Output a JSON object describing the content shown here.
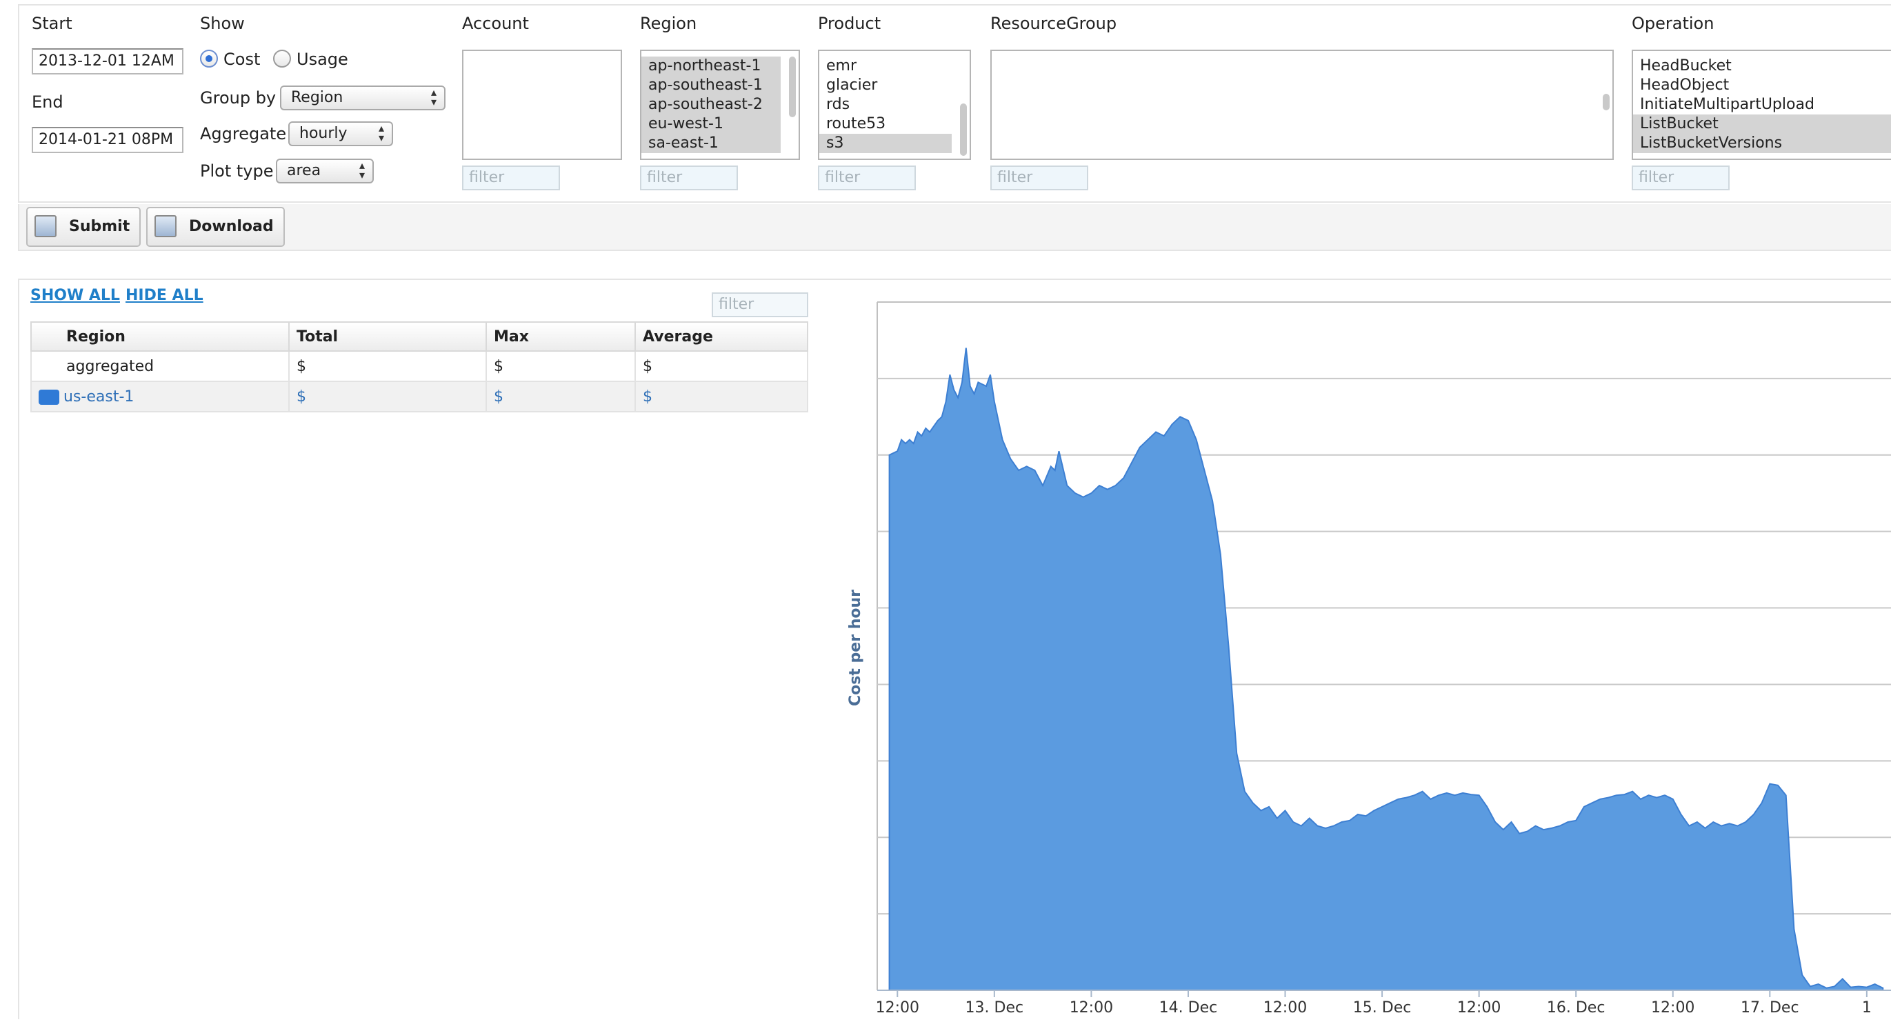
{
  "controls": {
    "start_label": "Start",
    "start_value": "2013-12-01 12AM",
    "end_label": "End",
    "end_value": "2014-01-21 08PM",
    "show_label": "Show",
    "cost_label": "Cost",
    "usage_label": "Usage",
    "show_selected": "Cost",
    "group_by_label": "Group by",
    "group_by_value": "Region",
    "aggregate_label": "Aggregate",
    "aggregate_value": "hourly",
    "plot_type_label": "Plot type",
    "plot_type_value": "area"
  },
  "filters": {
    "account": {
      "label": "Account",
      "options": [],
      "filter_placeholder": "filter"
    },
    "region": {
      "label": "Region",
      "options": [
        "ap-northeast-1",
        "ap-southeast-1",
        "ap-southeast-2",
        "eu-west-1",
        "sa-east-1"
      ],
      "selected": [
        "ap-northeast-1",
        "ap-southeast-1",
        "ap-southeast-2",
        "eu-west-1",
        "sa-east-1"
      ],
      "filter_placeholder": "filter"
    },
    "product": {
      "label": "Product",
      "options": [
        "emr",
        "glacier",
        "rds",
        "route53",
        "s3"
      ],
      "selected": [
        "s3"
      ],
      "filter_placeholder": "filter"
    },
    "resource_group": {
      "label": "ResourceGroup",
      "options": [],
      "filter_placeholder": "filter"
    },
    "operation": {
      "label": "Operation",
      "options": [
        "HeadBucket",
        "HeadObject",
        "InitiateMultipartUpload",
        "ListBucket",
        "ListBucketVersions"
      ],
      "selected": [
        "ListBucket",
        "ListBucketVersions"
      ],
      "filter_placeholder": "filter"
    }
  },
  "toolbar": {
    "submit_label": "Submit",
    "download_label": "Download"
  },
  "legend_panel": {
    "show_all": "SHOW ALL",
    "hide_all": "HIDE ALL",
    "filter_placeholder": "filter",
    "columns": [
      "Region",
      "Total",
      "Max",
      "Average"
    ],
    "rows": [
      {
        "name": "aggregated",
        "total": "$",
        "max": "$",
        "average": "$"
      },
      {
        "name": "us-east-1",
        "total": "$",
        "max": "$",
        "average": "$",
        "color": "#2f7ad6"
      }
    ]
  },
  "chart_data": {
    "type": "area",
    "ylabel": "Cost per hour",
    "series": [
      {
        "name": "us-east-1",
        "color": "#5b9be0"
      }
    ],
    "x_tick_labels": [
      "12:00",
      "13. Dec",
      "12:00",
      "14. Dec",
      "12:00",
      "15. Dec",
      "12:00",
      "16. Dec",
      "12:00",
      "17. Dec",
      "1"
    ],
    "x_hours": [
      0,
      12,
      24,
      36,
      48,
      60,
      72,
      84,
      96,
      108,
      120
    ],
    "y_gridlines": 9,
    "ylim": [
      0,
      9
    ],
    "note_y": "y values in gridline units (axis tick labels not shown)",
    "points": [
      [
        -1,
        7.0
      ],
      [
        0,
        7.05
      ],
      [
        0.5,
        7.2
      ],
      [
        1,
        7.15
      ],
      [
        1.5,
        7.2
      ],
      [
        2,
        7.15
      ],
      [
        2.5,
        7.3
      ],
      [
        3,
        7.25
      ],
      [
        3.5,
        7.35
      ],
      [
        4,
        7.3
      ],
      [
        5,
        7.45
      ],
      [
        5.5,
        7.5
      ],
      [
        6,
        7.7
      ],
      [
        6.5,
        8.05
      ],
      [
        7,
        7.85
      ],
      [
        7.5,
        7.75
      ],
      [
        8,
        7.95
      ],
      [
        8.5,
        8.4
      ],
      [
        9,
        7.9
      ],
      [
        9.5,
        7.8
      ],
      [
        10,
        7.95
      ],
      [
        11,
        7.9
      ],
      [
        11.5,
        8.05
      ],
      [
        12,
        7.7
      ],
      [
        13,
        7.2
      ],
      [
        14,
        6.95
      ],
      [
        15,
        6.8
      ],
      [
        16,
        6.85
      ],
      [
        17,
        6.8
      ],
      [
        18,
        6.6
      ],
      [
        19,
        6.85
      ],
      [
        19.5,
        6.8
      ],
      [
        20,
        7.05
      ],
      [
        21,
        6.6
      ],
      [
        22,
        6.5
      ],
      [
        23,
        6.45
      ],
      [
        24,
        6.5
      ],
      [
        25,
        6.6
      ],
      [
        26,
        6.55
      ],
      [
        27,
        6.6
      ],
      [
        28,
        6.7
      ],
      [
        29,
        6.9
      ],
      [
        30,
        7.1
      ],
      [
        31,
        7.2
      ],
      [
        32,
        7.3
      ],
      [
        33,
        7.25
      ],
      [
        34,
        7.4
      ],
      [
        35,
        7.5
      ],
      [
        36,
        7.45
      ],
      [
        37,
        7.2
      ],
      [
        38,
        6.8
      ],
      [
        39,
        6.4
      ],
      [
        40,
        5.7
      ],
      [
        41,
        4.5
      ],
      [
        42,
        3.1
      ],
      [
        43,
        2.6
      ],
      [
        44,
        2.45
      ],
      [
        45,
        2.35
      ],
      [
        46,
        2.4
      ],
      [
        47,
        2.25
      ],
      [
        48,
        2.35
      ],
      [
        49,
        2.2
      ],
      [
        50,
        2.15
      ],
      [
        51,
        2.25
      ],
      [
        52,
        2.15
      ],
      [
        53,
        2.12
      ],
      [
        54,
        2.15
      ],
      [
        55,
        2.2
      ],
      [
        56,
        2.22
      ],
      [
        57,
        2.3
      ],
      [
        58,
        2.28
      ],
      [
        59,
        2.35
      ],
      [
        60,
        2.4
      ],
      [
        61,
        2.45
      ],
      [
        62,
        2.5
      ],
      [
        63,
        2.52
      ],
      [
        64,
        2.55
      ],
      [
        65,
        2.6
      ],
      [
        66,
        2.5
      ],
      [
        67,
        2.55
      ],
      [
        68,
        2.58
      ],
      [
        69,
        2.55
      ],
      [
        70,
        2.58
      ],
      [
        71,
        2.56
      ],
      [
        72,
        2.55
      ],
      [
        73,
        2.4
      ],
      [
        74,
        2.2
      ],
      [
        75,
        2.1
      ],
      [
        76,
        2.2
      ],
      [
        77,
        2.05
      ],
      [
        78,
        2.08
      ],
      [
        79,
        2.15
      ],
      [
        80,
        2.1
      ],
      [
        81,
        2.12
      ],
      [
        82,
        2.15
      ],
      [
        83,
        2.2
      ],
      [
        84,
        2.22
      ],
      [
        85,
        2.4
      ],
      [
        86,
        2.45
      ],
      [
        87,
        2.5
      ],
      [
        88,
        2.52
      ],
      [
        89,
        2.55
      ],
      [
        90,
        2.56
      ],
      [
        91,
        2.6
      ],
      [
        92,
        2.5
      ],
      [
        93,
        2.55
      ],
      [
        94,
        2.52
      ],
      [
        95,
        2.55
      ],
      [
        96,
        2.5
      ],
      [
        97,
        2.3
      ],
      [
        98,
        2.15
      ],
      [
        99,
        2.2
      ],
      [
        100,
        2.12
      ],
      [
        101,
        2.2
      ],
      [
        102,
        2.15
      ],
      [
        103,
        2.18
      ],
      [
        104,
        2.15
      ],
      [
        105,
        2.2
      ],
      [
        106,
        2.3
      ],
      [
        107,
        2.45
      ],
      [
        108,
        2.7
      ],
      [
        109,
        2.68
      ],
      [
        110,
        2.55
      ],
      [
        111,
        0.8
      ],
      [
        112,
        0.2
      ],
      [
        113,
        0.05
      ],
      [
        114,
        0.08
      ],
      [
        115,
        0.03
      ],
      [
        116,
        0.05
      ],
      [
        117,
        0.15
      ],
      [
        118,
        0.04
      ],
      [
        119,
        0.05
      ],
      [
        120,
        0.04
      ],
      [
        121,
        0.08
      ],
      [
        122,
        0.03
      ]
    ]
  }
}
